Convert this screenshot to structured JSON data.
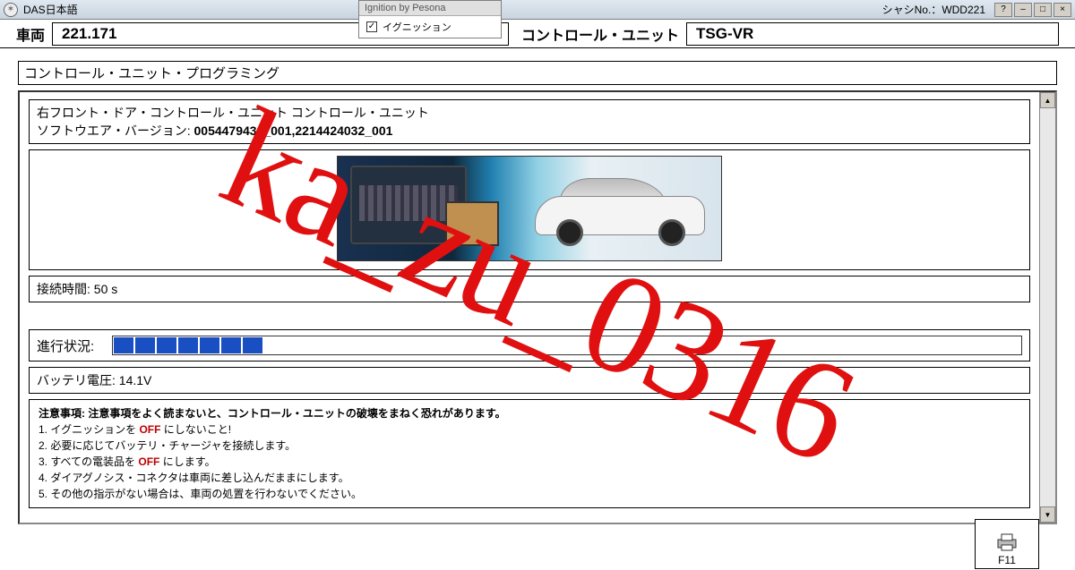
{
  "titlebar": {
    "app_name": "DAS日本語",
    "chassis_label": "シャシNo.：",
    "chassis_value": "WDD221"
  },
  "popup": {
    "header": "Ignition by Pesona",
    "checked": true,
    "label": "イグニッション"
  },
  "header": {
    "vehicle_label": "車両",
    "vehicle_value": "221.171",
    "ecu_label": "コントロール・ユニット",
    "ecu_value": "TSG-VR"
  },
  "section_title": "コントロール・ユニット・プログラミング",
  "info": {
    "line1": "右フロント・ドア・コントロール・ユニット コントロール・ユニット",
    "line2_label": "ソフトウエア・バージョン: ",
    "line2_value": "0054479432_001,2214424032_001"
  },
  "connection": {
    "label": "接続時間: ",
    "value": "50 s"
  },
  "progress": {
    "label": "進行状況:",
    "segments": 7
  },
  "battery": {
    "label": "バッテリ電圧: ",
    "value": "14.1V"
  },
  "notes": {
    "title": "注意事項: 注意事項をよく読まないと、コントロール・ユニットの破壊をまねく恐れがあります。",
    "items": [
      {
        "pre": "1. イグニッションを",
        "off": " OFF ",
        "post": "にしないこと!"
      },
      {
        "pre": "2. 必要に応じてバッテリ・チャージャを接続します。",
        "off": "",
        "post": ""
      },
      {
        "pre": "3. すべての電装品を",
        "off": " OFF ",
        "post": "にします。"
      },
      {
        "pre": "4. ダイアグノシス・コネクタは車両に差し込んだままにします。",
        "off": "",
        "post": ""
      },
      {
        "pre": "5. その他の指示がない場合は、車両の処置を行わないでください。",
        "off": "",
        "post": ""
      }
    ]
  },
  "fkey": {
    "f11": "F11"
  },
  "watermark": "ka_zu_0316"
}
